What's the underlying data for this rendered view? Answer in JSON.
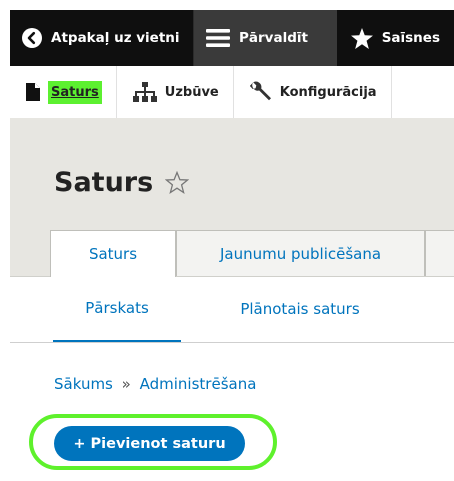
{
  "toolbar": {
    "back_label": "Atpakaļ uz vietni",
    "manage_label": "Pārvaldīt",
    "shortcuts_label": "Saīsnes",
    "icons": {
      "back": "back-arrow-icon",
      "manage": "hamburger-menu-icon",
      "shortcuts": "star-icon"
    }
  },
  "tray": {
    "items": [
      {
        "label": "Saturs",
        "icon": "file-icon",
        "active": true
      },
      {
        "label": "Uzbūve",
        "icon": "sitemap-icon"
      },
      {
        "label": "Konfigurācija",
        "icon": "wrench-icon"
      }
    ],
    "highlight_color": "#5cf030"
  },
  "page": {
    "title": "Saturs",
    "tabs": [
      {
        "label": "Saturs",
        "active": true
      },
      {
        "label": "Jaunumu publicēšana"
      }
    ],
    "subtabs": [
      {
        "label": "Pārskats",
        "active": true
      },
      {
        "label": "Plānotais saturs"
      }
    ]
  },
  "breadcrumb": {
    "items": [
      "Sākums",
      "Administrēšana"
    ],
    "separator": "»"
  },
  "actions": {
    "add_content": "+ Pievienot saturu"
  },
  "colors": {
    "link": "#0074bd",
    "toolbar_bg": "#0f0f0f",
    "highlight": "#5ef12c"
  }
}
